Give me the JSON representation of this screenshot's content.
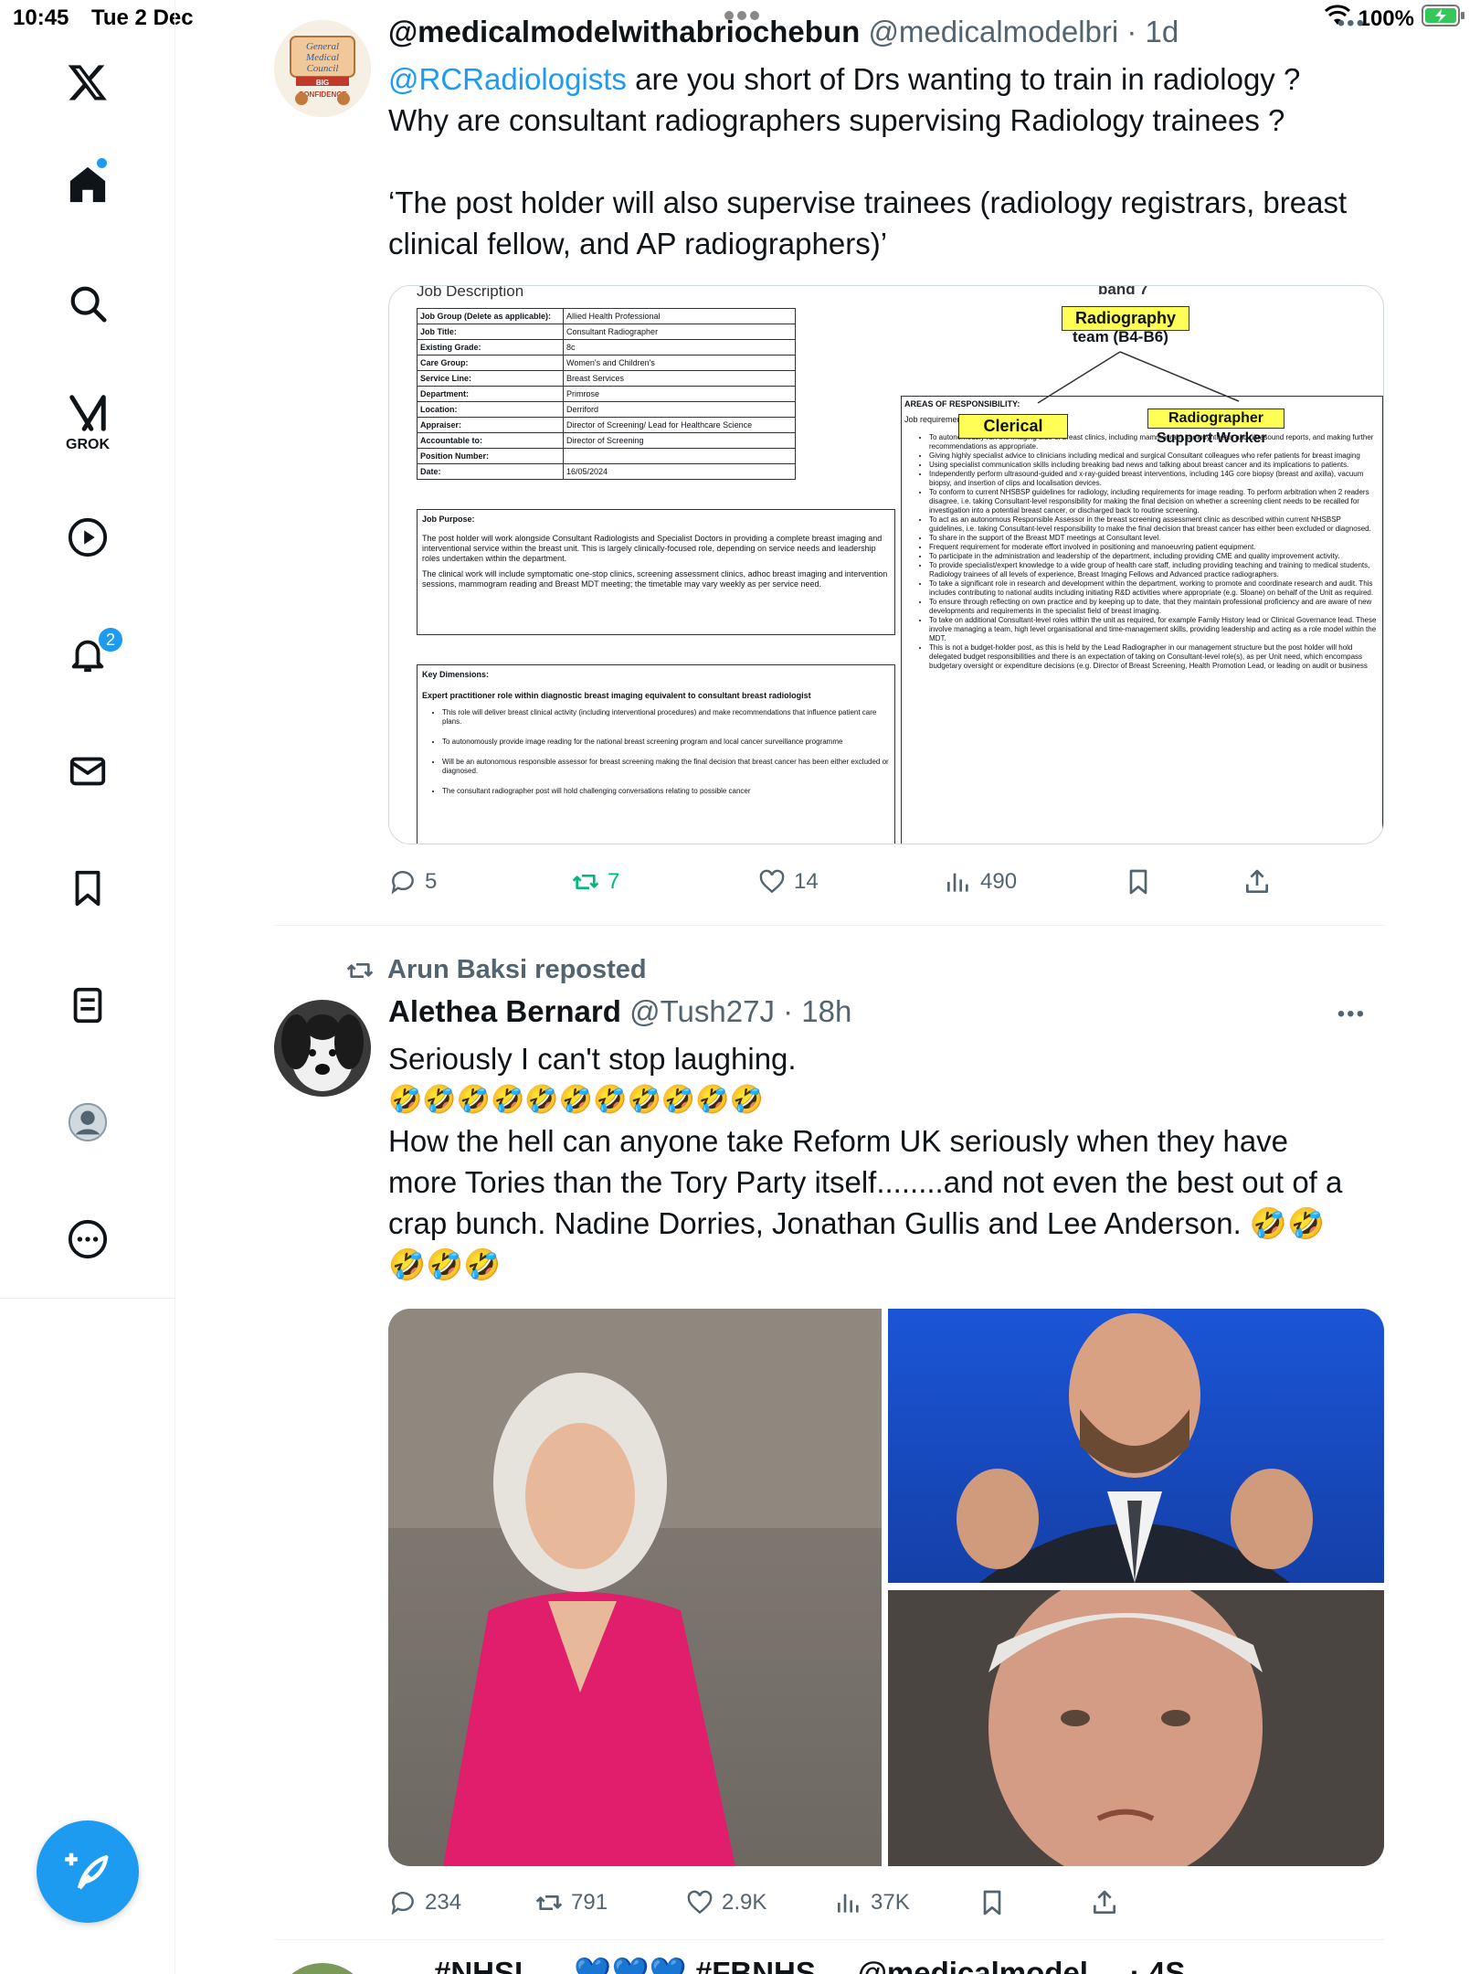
{
  "status_bar": {
    "time": "10:45",
    "date": "Tue 2 Dec",
    "battery": "100%"
  },
  "sidebar": {
    "grok_label": "GROK",
    "notification_count": "2"
  },
  "post1": {
    "author_name": "@medicalmodelwithabriochebun",
    "handle_time": "@medicalmodelbri · 1d",
    "avatar_text": [
      "General",
      "Medical",
      "Council",
      "BIG",
      "CONFIDENCE"
    ],
    "mention": "@RCRadiologists",
    "line1_rest": " are you short of Drs wanting to train in radiology ?",
    "line2": "Why are consultant radiographers supervising Radiology trainees ?",
    "line3": "‘The post holder will also supervise trainees (radiology registrars, breast",
    "line4": "clinical fellow, and AP radiographers)’",
    "doc_left": {
      "heading": "Job Description",
      "rows": [
        [
          "Job Group (Delete as applicable):",
          "Allied Health Professional"
        ],
        [
          "Job Title:",
          "Consultant Radiographer"
        ],
        [
          "Existing Grade:",
          "8c"
        ],
        [
          "Care Group:",
          "Women's and Children's"
        ],
        [
          "Service Line:",
          "Breast Services"
        ],
        [
          "Department:",
          "Primrose"
        ],
        [
          "Location:",
          "Derriford"
        ],
        [
          "Appraiser:",
          "Director of Screening/ Lead for Healthcare Science"
        ],
        [
          "Accountable to:",
          "Director of Screening"
        ],
        [
          "Position Number:",
          ""
        ],
        [
          "Date:",
          "16/05/2024"
        ]
      ],
      "purpose_title": "Job Purpose:",
      "purpose_p1": "The post holder will work alongside Consultant Radiologists and Specialist Doctors in providing a complete breast imaging and interventional service within the breast unit. This is largely clinically-focused role, depending on service needs and leadership roles undertaken within the department.",
      "purpose_p2": "The clinical work will include symptomatic one-stop clinics, screening assessment clinics, adhoc breast imaging and intervention sessions, mammogram reading and Breast MDT meeting; the timetable may vary weekly as per service need.",
      "key_title": "Key Dimensions:",
      "key_sub": "Expert practitioner role within diagnostic breast imaging equivalent to consultant breast radiologist",
      "key_items": [
        "This role will deliver breast clinical activity (including interventional procedures) and make recommendations that influence patient care plans.",
        "To autonomously provide image reading for the national breast screening program and local cancer surveillance programme",
        "Will be an autonomous responsible assessor for breast screening making the final decision that breast cancer has been either excluded or diagnosed.",
        "The consultant radiographer post will hold challenging conversations relating to possible cancer"
      ]
    },
    "doc_right": {
      "band": "band 7",
      "radiography": "Radiography",
      "team": "team (B4-B6)",
      "areas": "AREAS OF RESPONSIBILITY:",
      "job_req": "Job requirement",
      "clerical": "Clerical",
      "radiographer": "Radiographer",
      "support": "Support Worker",
      "items": [
        "To autonomously run the imaging side of breast clinics, including mammogram, tomosynthesis and ultrasound reports, and making further recommendations as appropriate.",
        "Giving highly specialist advice to clinicians including medical and surgical Consultant colleagues who refer patients for breast imaging",
        "Using specialist communication skills including breaking bad news and talking about breast cancer and its implications to patients.",
        "Independently perform ultrasound-guided and x-ray-guided breast interventions, including 14G core biopsy (breast and axilla), vacuum biopsy, and insertion of clips and localisation devices.",
        "To conform to current NHSBSP guidelines for radiology, including requirements for image reading. To perform arbitration when 2 readers disagree, i.e. taking Consultant-level responsibility for making the final decision on whether a screening client needs to be recalled for investigation into a potential breast cancer, or discharged back to routine screening.",
        "To act as an autonomous Responsible Assessor in the breast screening assessment clinic as described within current NHSBSP guidelines, i.e. taking Consultant-level responsibility to make the final decision that breast cancer has either been excluded or diagnosed.",
        "To share in the support of the Breast MDT meetings at Consultant level.",
        "Frequent requirement for moderate effort involved in positioning and manoeuvring patient equipment.",
        "To participate in the administration and leadership of the department, including providing CME and quality improvement activity.",
        "To provide specialist/expert knowledge to a wide group of health care staff, including providing teaching and training to medical students, Radiology trainees of all levels of experience, Breast Imaging Fellows and Advanced practice radiographers.",
        "To take a significant role in research and development within the department, working to promote and coordinate research and audit. This includes contributing to national audits including initiating R&D activities where appropriate (e.g. Sloane) on behalf of the Unit as required.",
        "To ensure through reflecting on own practice and by keeping up to date, that they maintain professional proficiency and are aware of new developments and requirements in the specialist field of breast imaging.",
        "To take on additional Consultant-level roles within the unit as required, for example Family History lead or Clinical Governance lead. These involve managing a team, high level organisational and time-management skills, providing leadership and acting as a role model within the MDT.",
        "This is not a budget-holder post, as this is held by the Lead Radiographer in our management structure but the post holder will hold delegated budget responsibilities and there is an expectation of taking on Consultant-level role(s), as per Unit need, which encompass budgetary oversight or expenditure decisions (e.g. Director of Breast Screening, Health Promotion Lead, or leading on audit or business"
      ]
    },
    "replies": "5",
    "reposts": "7",
    "likes": "14",
    "views": "490"
  },
  "post2": {
    "reposted_by": "Arun Baksi reposted",
    "author_name": "Alethea Bernard",
    "handle_time": "@Tush27J · 18h",
    "line1": "Seriously I can't stop laughing.",
    "emojis_line": "🤣🤣🤣🤣🤣🤣🤣🤣🤣🤣🤣",
    "line3": "How the hell can anyone take Reform UK seriously when they have",
    "line4": "more Tories than the Tory Party itself........and not even the best out of a",
    "line5": "crap bunch. Nadine Dorries, Jonathan Gullis and Lee Anderson. 🤣🤣",
    "line6": "🤣🤣🤣",
    "replies": "234",
    "reposts": "791",
    "likes": "2.9K",
    "views": "37K"
  },
  "post3": {
    "partial_text": "#NHSL ... 💙💙💙 #FBNHS ... @medicalmodel ... · 4S"
  },
  "colors": {
    "accent": "#1d9bf0",
    "repost_green": "#00ba7c",
    "muted": "#536471"
  }
}
